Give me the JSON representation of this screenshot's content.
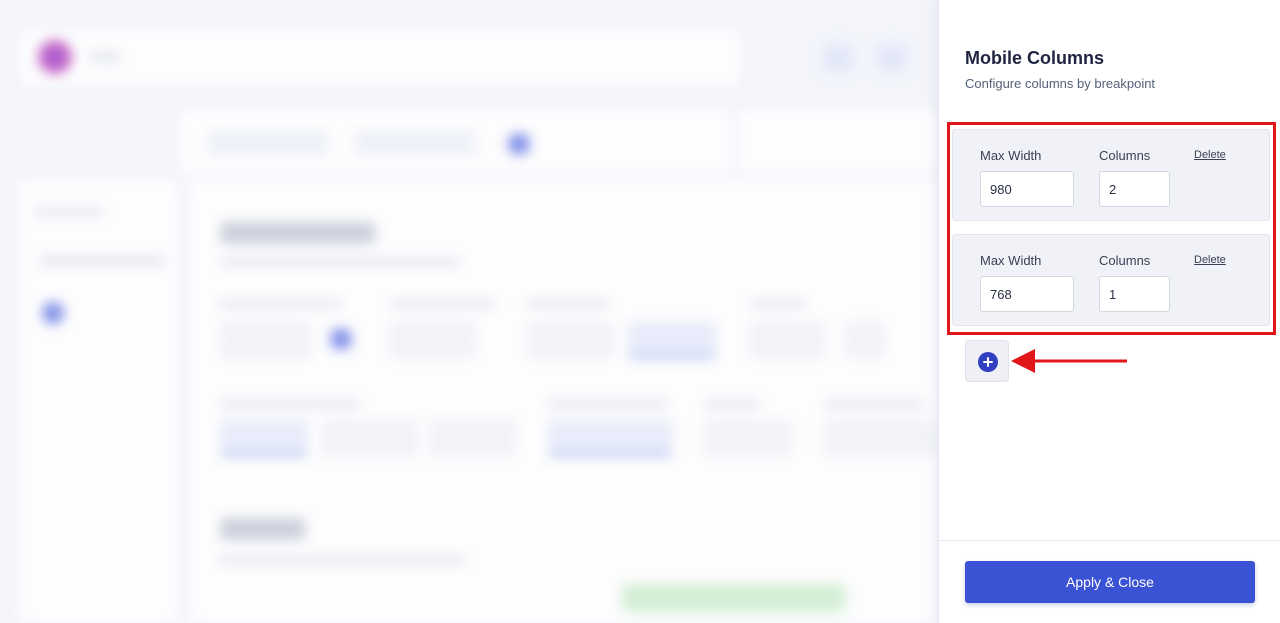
{
  "panel": {
    "title": "Mobile Columns",
    "subtitle": "Configure columns by breakpoint",
    "rows": [
      {
        "max_width_label": "Max Width",
        "columns_label": "Columns",
        "delete_label": "Delete",
        "max_width_value": "980",
        "columns_value": "2"
      },
      {
        "max_width_label": "Max Width",
        "columns_label": "Columns",
        "delete_label": "Delete",
        "max_width_value": "768",
        "columns_value": "1"
      }
    ],
    "add_button_icon": "plus-circle-icon",
    "apply_label": "Apply & Close"
  },
  "colors": {
    "accent": "#3a52d4",
    "highlight": "#e0161b",
    "add_icon": "#2f3fc0"
  }
}
